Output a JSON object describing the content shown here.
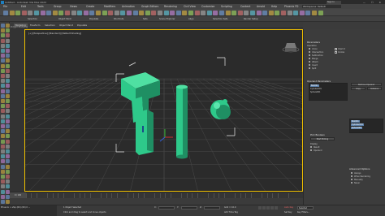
{
  "app": {
    "title": "Untitled - Autodesk 3ds Max 2023",
    "sign_in": "Sign In",
    "window_controls": "— ☐ ✕"
  },
  "menu": {
    "items": [
      "File",
      "Edit",
      "Tools",
      "Group",
      "Views",
      "Create",
      "Modifiers",
      "Animation",
      "Graph Editors",
      "Rendering",
      "Civil View",
      "Customize",
      "Scripting",
      "Content",
      "Arnold",
      "Help",
      "Phoenix FD"
    ],
    "workspace": "Workspaces: Default"
  },
  "toolbar2": {
    "labels": [
      "Selection",
      "Object Paint",
      "Populate",
      "Shortcuts",
      "Sets",
      "Scene Explorer",
      "Align",
      "Selection Sets",
      "Render Setup"
    ]
  },
  "ribbon": {
    "tabs": [
      "Modeling",
      "Freeform",
      "Selection",
      "Object Paint",
      "Populate"
    ],
    "active": "Modeling",
    "sub_label": "Polygon Modeling"
  },
  "viewport": {
    "label": "[+] [Perspective] [Standard] [Default Shading]"
  },
  "command_panel": {
    "section_parameters": "Parameters",
    "operation_label": "Operation",
    "operations": [
      "Union",
      "Intersection",
      "Subtraction",
      "Merge",
      "Attach",
      "Insert",
      "Split"
    ],
    "imprint": "Imprint",
    "cookie": "Cookie",
    "operand_params": "Operand Parameters",
    "operand_list": [
      "Box001",
      "Cylinder001",
      "Sphere001"
    ],
    "remove_btn": "Remove Operand",
    "copy_btn": "Copy",
    "instance_btn": "Instance",
    "pick_boolean": "Pick Boolean",
    "pick_op_btn": "Start Picking",
    "display_label": "Display",
    "display_opts": [
      "Result",
      "Operand"
    ],
    "advanced": "Advanced Options",
    "advanced_opts": [
      "Always",
      "When Rendering",
      "Manually",
      "Never"
    ]
  },
  "timeline": {
    "position": "0 / 100"
  },
  "status": {
    "script": "Phoenix > ship (60) (60) 0 ...",
    "selected": "1 Object Selected",
    "hint": "Click and drag to select and move objects",
    "x_label": "X:",
    "y_label": "Y:",
    "z_label": "Z:",
    "grid": "Grid = 10.0",
    "add_time_tag": "Add Time Tag",
    "auto_key": "Auto Key",
    "selected_mode": "Selected",
    "set_key": "Set Key",
    "key_filters": "Key Filters..."
  },
  "colors": {
    "object_green": "#2ec98a",
    "object_green_dark": "#1f8f63",
    "selection_box": "#e8e8e8",
    "viewport_border": "#f0c000",
    "grid_line": "#4a4a4a",
    "accent_blue": "#5b7fa8"
  }
}
